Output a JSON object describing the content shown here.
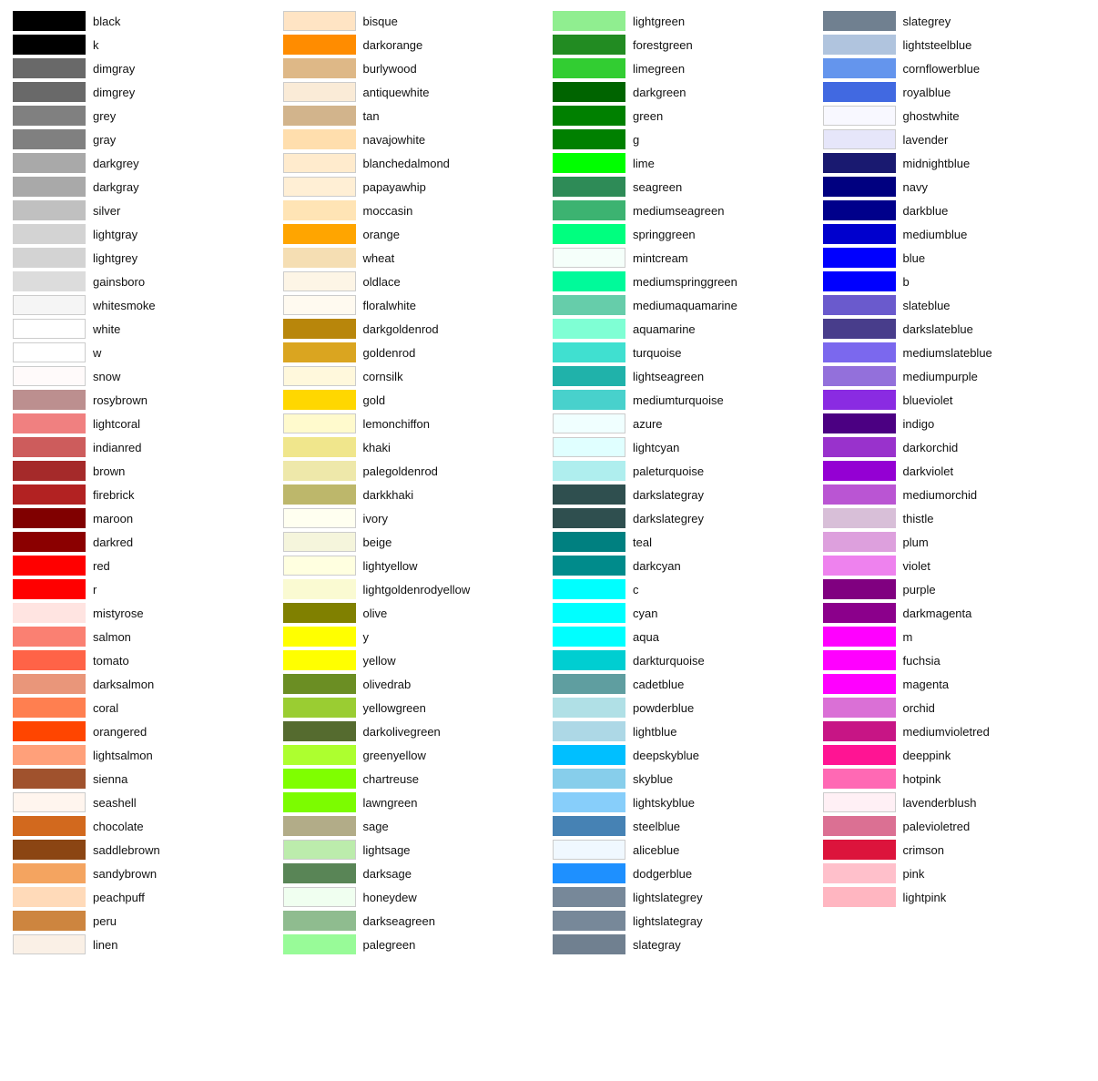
{
  "columns": [
    {
      "id": "col1",
      "items": [
        {
          "name": "black",
          "color": "#000000"
        },
        {
          "name": "k",
          "color": "#000000"
        },
        {
          "name": "dimgray",
          "color": "#696969"
        },
        {
          "name": "dimgrey",
          "color": "#696969"
        },
        {
          "name": "grey",
          "color": "#808080"
        },
        {
          "name": "gray",
          "color": "#808080"
        },
        {
          "name": "darkgrey",
          "color": "#A9A9A9"
        },
        {
          "name": "darkgray",
          "color": "#A9A9A9"
        },
        {
          "name": "silver",
          "color": "#C0C0C0"
        },
        {
          "name": "lightgray",
          "color": "#D3D3D3"
        },
        {
          "name": "lightgrey",
          "color": "#D3D3D3"
        },
        {
          "name": "gainsboro",
          "color": "#DCDCDC"
        },
        {
          "name": "whitesmoke",
          "color": "#F5F5F5"
        },
        {
          "name": "white",
          "color": "#FFFFFF"
        },
        {
          "name": "w",
          "color": "#FFFFFF"
        },
        {
          "name": "snow",
          "color": "#FFFAFA"
        },
        {
          "name": "rosybrown",
          "color": "#BC8F8F"
        },
        {
          "name": "lightcoral",
          "color": "#F08080"
        },
        {
          "name": "indianred",
          "color": "#CD5C5C"
        },
        {
          "name": "brown",
          "color": "#A52A2A"
        },
        {
          "name": "firebrick",
          "color": "#B22222"
        },
        {
          "name": "maroon",
          "color": "#800000"
        },
        {
          "name": "darkred",
          "color": "#8B0000"
        },
        {
          "name": "red",
          "color": "#FF0000"
        },
        {
          "name": "r",
          "color": "#FF0000"
        },
        {
          "name": "mistyrose",
          "color": "#FFE4E1"
        },
        {
          "name": "salmon",
          "color": "#FA8072"
        },
        {
          "name": "tomato",
          "color": "#FF6347"
        },
        {
          "name": "darksalmon",
          "color": "#E9967A"
        },
        {
          "name": "coral",
          "color": "#FF7F50"
        },
        {
          "name": "orangered",
          "color": "#FF4500"
        },
        {
          "name": "lightsalmon",
          "color": "#FFA07A"
        },
        {
          "name": "sienna",
          "color": "#A0522D"
        },
        {
          "name": "seashell",
          "color": "#FFF5EE"
        },
        {
          "name": "chocolate",
          "color": "#D2691E"
        },
        {
          "name": "saddlebrown",
          "color": "#8B4513"
        },
        {
          "name": "sandybrown",
          "color": "#F4A460"
        },
        {
          "name": "peachpuff",
          "color": "#FFDAB9"
        },
        {
          "name": "peru",
          "color": "#CD853F"
        },
        {
          "name": "linen",
          "color": "#FAF0E6"
        }
      ]
    },
    {
      "id": "col2",
      "items": [
        {
          "name": "bisque",
          "color": "#FFE4C4"
        },
        {
          "name": "darkorange",
          "color": "#FF8C00"
        },
        {
          "name": "burlywood",
          "color": "#DEB887"
        },
        {
          "name": "antiquewhite",
          "color": "#FAEBD7"
        },
        {
          "name": "tan",
          "color": "#D2B48C"
        },
        {
          "name": "navajowhite",
          "color": "#FFDEAD"
        },
        {
          "name": "blanchedalmond",
          "color": "#FFEBCD"
        },
        {
          "name": "papayawhip",
          "color": "#FFEFD5"
        },
        {
          "name": "moccasin",
          "color": "#FFE4B5"
        },
        {
          "name": "orange",
          "color": "#FFA500"
        },
        {
          "name": "wheat",
          "color": "#F5DEB3"
        },
        {
          "name": "oldlace",
          "color": "#FDF5E6"
        },
        {
          "name": "floralwhite",
          "color": "#FFFAF0"
        },
        {
          "name": "darkgoldenrod",
          "color": "#B8860B"
        },
        {
          "name": "goldenrod",
          "color": "#DAA520"
        },
        {
          "name": "cornsilk",
          "color": "#FFF8DC"
        },
        {
          "name": "gold",
          "color": "#FFD700"
        },
        {
          "name": "lemonchiffon",
          "color": "#FFFACD"
        },
        {
          "name": "khaki",
          "color": "#F0E68C"
        },
        {
          "name": "palegoldenrod",
          "color": "#EEE8AA"
        },
        {
          "name": "darkkhaki",
          "color": "#BDB76B"
        },
        {
          "name": "ivory",
          "color": "#FFFFF0"
        },
        {
          "name": "beige",
          "color": "#F5F5DC"
        },
        {
          "name": "lightyellow",
          "color": "#FFFFE0"
        },
        {
          "name": "lightgoldenrodyellow",
          "color": "#FAFAD2"
        },
        {
          "name": "olive",
          "color": "#808000"
        },
        {
          "name": "y",
          "color": "#FFFF00"
        },
        {
          "name": "yellow",
          "color": "#FFFF00"
        },
        {
          "name": "olivedrab",
          "color": "#6B8E23"
        },
        {
          "name": "yellowgreen",
          "color": "#9ACD32"
        },
        {
          "name": "darkolivegreen",
          "color": "#556B2F"
        },
        {
          "name": "greenyellow",
          "color": "#ADFF2F"
        },
        {
          "name": "chartreuse",
          "color": "#7FFF00"
        },
        {
          "name": "lawngreen",
          "color": "#7CFC00"
        },
        {
          "name": "sage",
          "color": "#B2AC88"
        },
        {
          "name": "lightsage",
          "color": "#BCECAC"
        },
        {
          "name": "darksage",
          "color": "#598556"
        },
        {
          "name": "honeydew",
          "color": "#F0FFF0"
        },
        {
          "name": "darkseagreen",
          "color": "#8FBC8F"
        },
        {
          "name": "palegreen",
          "color": "#98FB98"
        }
      ]
    },
    {
      "id": "col3",
      "items": [
        {
          "name": "lightgreen",
          "color": "#90EE90"
        },
        {
          "name": "forestgreen",
          "color": "#228B22"
        },
        {
          "name": "limegreen",
          "color": "#32CD32"
        },
        {
          "name": "darkgreen",
          "color": "#006400"
        },
        {
          "name": "green",
          "color": "#008000"
        },
        {
          "name": "g",
          "color": "#008000"
        },
        {
          "name": "lime",
          "color": "#00FF00"
        },
        {
          "name": "seagreen",
          "color": "#2E8B57"
        },
        {
          "name": "mediumseagreen",
          "color": "#3CB371"
        },
        {
          "name": "springgreen",
          "color": "#00FF7F"
        },
        {
          "name": "mintcream",
          "color": "#F5FFFA"
        },
        {
          "name": "mediumspringgreen",
          "color": "#00FA9A"
        },
        {
          "name": "mediumaquamarine",
          "color": "#66CDAA"
        },
        {
          "name": "aquamarine",
          "color": "#7FFFD4"
        },
        {
          "name": "turquoise",
          "color": "#40E0D0"
        },
        {
          "name": "lightseagreen",
          "color": "#20B2AA"
        },
        {
          "name": "mediumturquoise",
          "color": "#48D1CC"
        },
        {
          "name": "azure",
          "color": "#F0FFFF"
        },
        {
          "name": "lightcyan",
          "color": "#E0FFFF"
        },
        {
          "name": "paleturquoise",
          "color": "#AFEEEE"
        },
        {
          "name": "darkslategray",
          "color": "#2F4F4F"
        },
        {
          "name": "darkslategrey",
          "color": "#2F4F4F"
        },
        {
          "name": "teal",
          "color": "#008080"
        },
        {
          "name": "darkcyan",
          "color": "#008B8B"
        },
        {
          "name": "c",
          "color": "#00FFFF"
        },
        {
          "name": "cyan",
          "color": "#00FFFF"
        },
        {
          "name": "aqua",
          "color": "#00FFFF"
        },
        {
          "name": "darkturquoise",
          "color": "#00CED1"
        },
        {
          "name": "cadetblue",
          "color": "#5F9EA0"
        },
        {
          "name": "powderblue",
          "color": "#B0E0E6"
        },
        {
          "name": "lightblue",
          "color": "#ADD8E6"
        },
        {
          "name": "deepskyblue",
          "color": "#00BFFF"
        },
        {
          "name": "skyblue",
          "color": "#87CEEB"
        },
        {
          "name": "lightskyblue",
          "color": "#87CEFA"
        },
        {
          "name": "steelblue",
          "color": "#4682B4"
        },
        {
          "name": "aliceblue",
          "color": "#F0F8FF"
        },
        {
          "name": "dodgerblue",
          "color": "#1E90FF"
        },
        {
          "name": "lightslategrey",
          "color": "#778899"
        },
        {
          "name": "lightslategray",
          "color": "#778899"
        },
        {
          "name": "slategray",
          "color": "#708090"
        }
      ]
    },
    {
      "id": "col4",
      "items": [
        {
          "name": "slategrey",
          "color": "#708090"
        },
        {
          "name": "lightsteelblue",
          "color": "#B0C4DE"
        },
        {
          "name": "cornflowerblue",
          "color": "#6495ED"
        },
        {
          "name": "royalblue",
          "color": "#4169E1"
        },
        {
          "name": "ghostwhite",
          "color": "#F8F8FF"
        },
        {
          "name": "lavender",
          "color": "#E6E6FA"
        },
        {
          "name": "midnightblue",
          "color": "#191970"
        },
        {
          "name": "navy",
          "color": "#000080"
        },
        {
          "name": "darkblue",
          "color": "#00008B"
        },
        {
          "name": "mediumblue",
          "color": "#0000CD"
        },
        {
          "name": "blue",
          "color": "#0000FF"
        },
        {
          "name": "b",
          "color": "#0000FF"
        },
        {
          "name": "slateblue",
          "color": "#6A5ACD"
        },
        {
          "name": "darkslateblue",
          "color": "#483D8B"
        },
        {
          "name": "mediumslateblue",
          "color": "#7B68EE"
        },
        {
          "name": "mediumpurple",
          "color": "#9370DB"
        },
        {
          "name": "blueviolet",
          "color": "#8A2BE2"
        },
        {
          "name": "indigo",
          "color": "#4B0082"
        },
        {
          "name": "darkorchid",
          "color": "#9932CC"
        },
        {
          "name": "darkviolet",
          "color": "#9400D3"
        },
        {
          "name": "mediumorchid",
          "color": "#BA55D3"
        },
        {
          "name": "thistle",
          "color": "#D8BFD8"
        },
        {
          "name": "plum",
          "color": "#DDA0DD"
        },
        {
          "name": "violet",
          "color": "#EE82EE"
        },
        {
          "name": "purple",
          "color": "#800080"
        },
        {
          "name": "darkmagenta",
          "color": "#8B008B"
        },
        {
          "name": "m",
          "color": "#FF00FF"
        },
        {
          "name": "fuchsia",
          "color": "#FF00FF"
        },
        {
          "name": "magenta",
          "color": "#FF00FF"
        },
        {
          "name": "orchid",
          "color": "#DA70D6"
        },
        {
          "name": "mediumvioletred",
          "color": "#C71585"
        },
        {
          "name": "deeppink",
          "color": "#FF1493"
        },
        {
          "name": "hotpink",
          "color": "#FF69B4"
        },
        {
          "name": "lavenderblush",
          "color": "#FFF0F5"
        },
        {
          "name": "palevioletred",
          "color": "#DB7093"
        },
        {
          "name": "crimson",
          "color": "#DC143C"
        },
        {
          "name": "pink",
          "color": "#FFC0CB"
        },
        {
          "name": "lightpink",
          "color": "#FFB6C1"
        }
      ]
    }
  ]
}
